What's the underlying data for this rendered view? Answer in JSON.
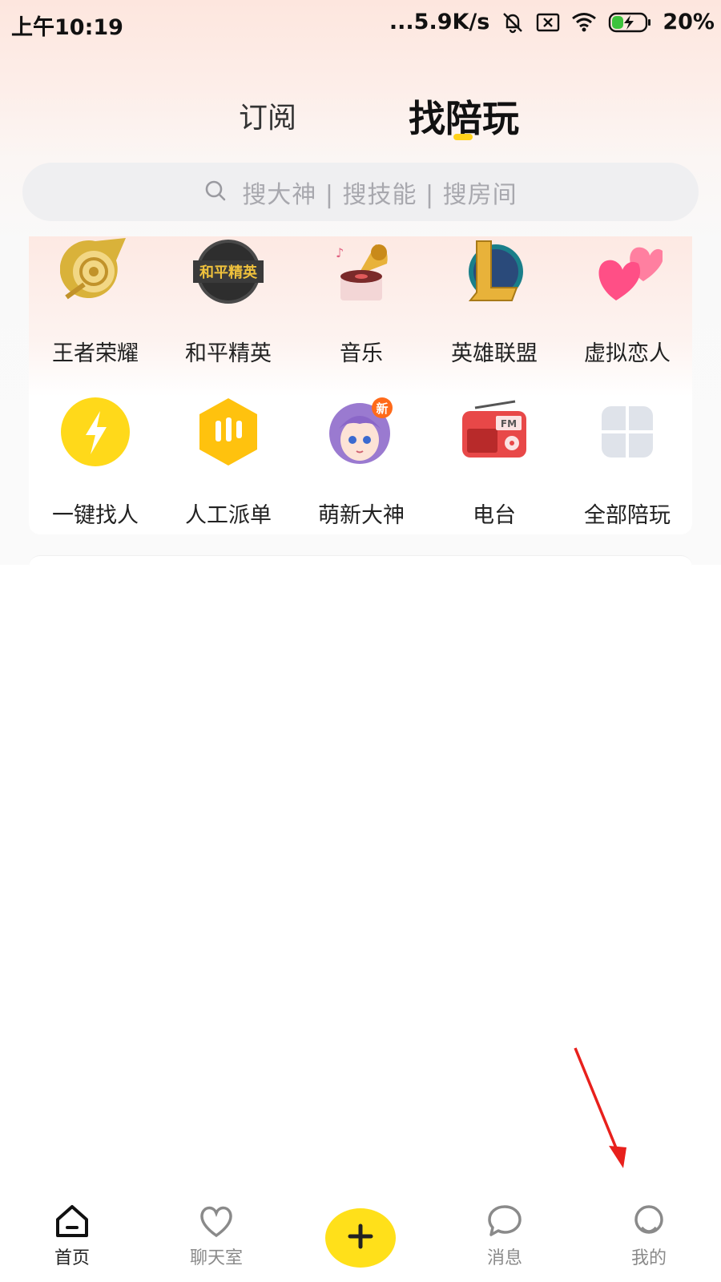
{
  "status_bar": {
    "time": "上午10:19",
    "network_speed": "...5.9K/s",
    "battery": "20%"
  },
  "tabs": {
    "subscribe": "订阅",
    "find_companion": "找陪玩",
    "active_color": "#ffd21a"
  },
  "search": {
    "placeholder": "搜大神 | 搜技能 | 搜房间"
  },
  "categories": [
    {
      "label": "王者荣耀",
      "icon": "honor-of-kings-icon"
    },
    {
      "label": "和平精英",
      "icon": "game-for-peace-icon",
      "icon_text": "和平精英"
    },
    {
      "label": "音乐",
      "icon": "gramophone-icon"
    },
    {
      "label": "英雄联盟",
      "icon": "league-of-legends-icon"
    },
    {
      "label": "虚拟恋人",
      "icon": "hearts-icon"
    },
    {
      "label": "一键找人",
      "icon": "lightning-icon"
    },
    {
      "label": "人工派单",
      "icon": "bars-icon"
    },
    {
      "label": "萌新大神",
      "icon": "anime-girl-icon",
      "badge": "新"
    },
    {
      "label": "电台",
      "icon": "radio-icon",
      "icon_text": "FM"
    },
    {
      "label": "全部陪玩",
      "icon": "all-grid-icon"
    }
  ],
  "bottom_nav": {
    "home": "首页",
    "chatroom": "聊天室",
    "messages": "消息",
    "mine": "我的"
  },
  "colors": {
    "accent_yellow": "#ffe01a",
    "annotation_arrow": "#e8201c"
  }
}
